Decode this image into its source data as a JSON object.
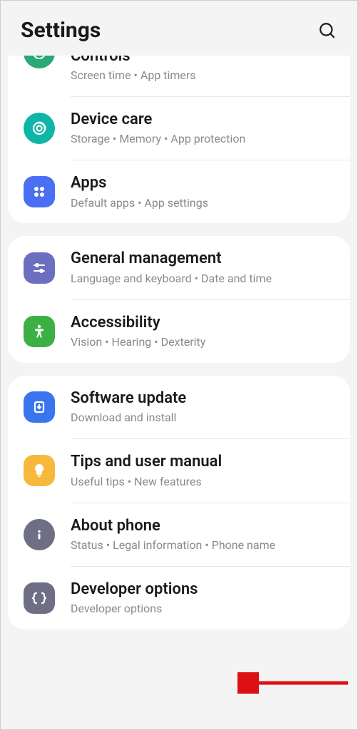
{
  "header": {
    "title": "Settings"
  },
  "groups": [
    {
      "items": [
        {
          "title_partial": "Controls",
          "sub": "Screen time  •  App timers",
          "icon": "wellbeing-icon",
          "bg": "bg-green"
        },
        {
          "title": "Device care",
          "sub": "Storage  •  Memory  •  App protection",
          "icon": "device-care-icon",
          "bg": "bg-teal"
        },
        {
          "title": "Apps",
          "sub": "Default apps  •  App settings",
          "icon": "apps-icon",
          "bg": "bg-blue-sq"
        }
      ]
    },
    {
      "items": [
        {
          "title": "General management",
          "sub": "Language and keyboard  •  Date and time",
          "icon": "sliders-icon",
          "bg": "bg-indigo"
        },
        {
          "title": "Accessibility",
          "sub": "Vision  •  Hearing  •  Dexterity",
          "icon": "accessibility-icon",
          "bg": "bg-green2"
        }
      ]
    },
    {
      "items": [
        {
          "title": "Software update",
          "sub": "Download and install",
          "icon": "download-icon",
          "bg": "bg-blue2"
        },
        {
          "title": "Tips and user manual",
          "sub": "Useful tips  •  New features",
          "icon": "lightbulb-icon",
          "bg": "bg-yellow"
        },
        {
          "title": "About phone",
          "sub": "Status  •  Legal information  •  Phone name",
          "icon": "info-icon",
          "bg": "bg-gray"
        },
        {
          "title": "Developer options",
          "sub": "Developer options",
          "icon": "code-icon",
          "bg": "bg-gray-sq"
        }
      ]
    }
  ]
}
